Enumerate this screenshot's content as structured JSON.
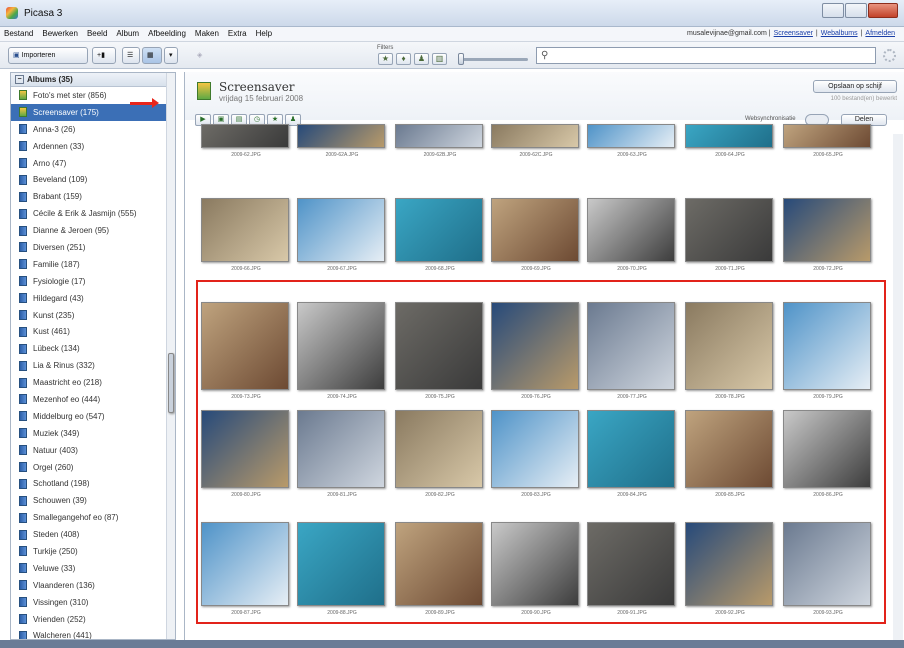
{
  "window": {
    "title": "Picasa 3"
  },
  "menu": [
    "Bestand",
    "Bewerken",
    "Beeld",
    "Album",
    "Afbeelding",
    "Maken",
    "Extra",
    "Help"
  ],
  "account": {
    "email": "musalevijnae@gmail.com",
    "links": [
      "Screensaver",
      "Webalbums",
      "Afmelden"
    ]
  },
  "toolbar": {
    "import_label": "Importeren",
    "filters_label": "Filters",
    "search_placeholder": ""
  },
  "sidebar": {
    "header": "Albums (35)",
    "albums": [
      {
        "label": "Foto's met ster (856)",
        "special": true
      },
      {
        "label": "Screensaver (175)",
        "special": true,
        "selected": true
      },
      {
        "label": "Anna-3 (26)"
      },
      {
        "label": "Ardennen (33)"
      },
      {
        "label": "Arno (47)"
      },
      {
        "label": "Beveland (109)"
      },
      {
        "label": "Brabant (159)"
      },
      {
        "label": "Cécile & Erik & Jasmijn (555)"
      },
      {
        "label": "Dianne & Jeroen (95)"
      },
      {
        "label": "Diversen (251)"
      },
      {
        "label": "Familie (187)"
      },
      {
        "label": "Fysiologie (17)"
      },
      {
        "label": "Hildegard (43)"
      },
      {
        "label": "Kunst (235)"
      },
      {
        "label": "Kust (461)"
      },
      {
        "label": "Lübeck (134)"
      },
      {
        "label": "Lia & Rinus (332)"
      },
      {
        "label": "Maastricht eo (218)"
      },
      {
        "label": "Mezenhof eo (444)"
      },
      {
        "label": "Middelburg eo (547)"
      },
      {
        "label": "Muziek (349)"
      },
      {
        "label": "Natuur (403)"
      },
      {
        "label": "Orgel (260)"
      },
      {
        "label": "Schotland (198)"
      },
      {
        "label": "Schouwen (39)"
      },
      {
        "label": "Smallegangehof eo (87)"
      },
      {
        "label": "Steden (408)"
      },
      {
        "label": "Turkije (250)"
      },
      {
        "label": "Veluwe (33)"
      },
      {
        "label": "Vlaanderen (136)"
      },
      {
        "label": "Vissingen (310)"
      },
      {
        "label": "Vrienden (252)"
      },
      {
        "label": "Walcheren (441)"
      },
      {
        "label": "Zutphen eo (134)"
      },
      {
        "label": "Zwitserland (171)"
      }
    ]
  },
  "album": {
    "name": "Screensaver",
    "date": "vrijdag 15 februari 2008",
    "save_label": "Opslaan op schijf",
    "count_label": "100 bestand(en) bewerkt",
    "web_toggle_label": "Websynchronisatie",
    "share_label": "Delen"
  },
  "photos": {
    "row1": [
      "2009-62.JPG",
      "2009-62A.JPG",
      "2009-62B.JPG",
      "2009-62C.JPG",
      "2009-63.JPG",
      "2009-64.JPG",
      "2009-65.JPG"
    ],
    "row2": [
      "2009-66.JPG",
      "2009-67.JPG",
      "2009-68.JPG",
      "2009-69.JPG",
      "2009-70.JPG",
      "2009-71.JPG",
      "2009-72.JPG"
    ],
    "row3": [
      "2009-73.JPG",
      "2009-74.JPG",
      "2009-75.JPG",
      "2009-76.JPG",
      "2009-77.JPG",
      "2009-78.JPG",
      "2009-79.JPG"
    ],
    "row4": [
      "2009-80.JPG",
      "2009-81.JPG",
      "2009-82.JPG",
      "2009-83.JPG",
      "2009-84.JPG",
      "2009-85.JPG",
      "2009-86.JPG"
    ],
    "row5": [
      "2009-87.JPG",
      "2009-88.JPG",
      "2009-89.JPG",
      "2009-90.JPG",
      "2009-91.JPG",
      "2009-92.JPG",
      "2009-93.JPG"
    ]
  },
  "colors": {
    "selected": "#3b6fb6",
    "highlight_box": "#e2231a",
    "pool": "#3aa6c4"
  }
}
